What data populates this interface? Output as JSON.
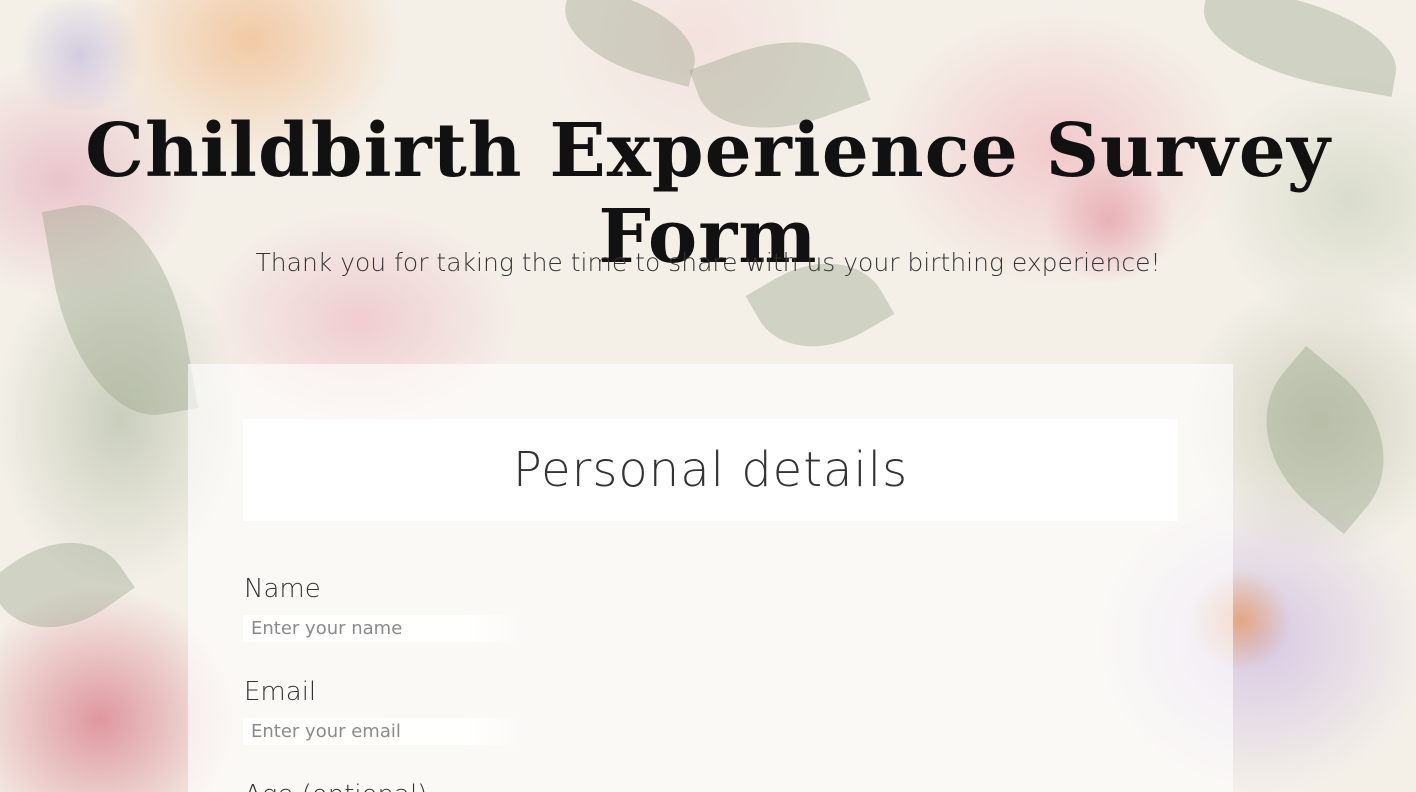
{
  "page": {
    "title": "Childbirth Experience Survey Form",
    "subtitle": "Thank you for taking the time to share with us your birthing experience!"
  },
  "section": {
    "heading": "Personal details"
  },
  "fields": {
    "name": {
      "label": "Name",
      "placeholder": "Enter your name",
      "value": ""
    },
    "email": {
      "label": "Email",
      "placeholder": "Enter your email",
      "value": ""
    },
    "age": {
      "label": "Age (optional)"
    }
  },
  "theme": {
    "background": "#f4f0e8",
    "card_background": "rgba(255,255,255,0.62)",
    "header_background": "#ffffff",
    "text_color": "#333333",
    "title_color": "#111111"
  }
}
